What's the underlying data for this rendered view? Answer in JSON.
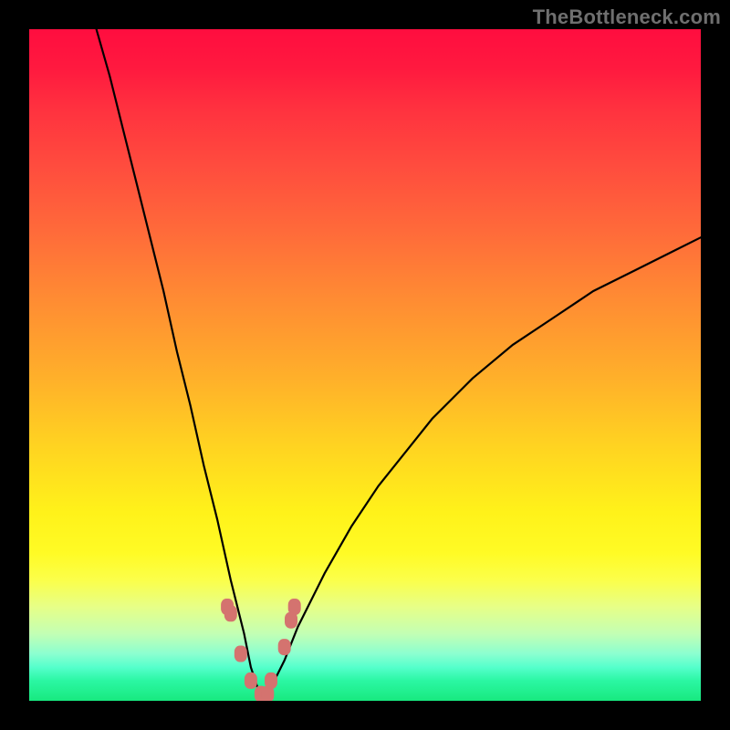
{
  "watermark": "TheBottleneck.com",
  "chart_data": {
    "type": "line",
    "title": "",
    "xlabel": "",
    "ylabel": "",
    "xlim": [
      0,
      100
    ],
    "ylim": [
      0,
      100
    ],
    "background_gradient": {
      "top_color": "#ff0d3f",
      "bottom_color": "#18e97f",
      "meaning": "bottleneck severity (red=high, green=low)"
    },
    "series": [
      {
        "name": "bottleneck-curve",
        "stroke": "#000000",
        "x": [
          10,
          12,
          14,
          16,
          18,
          20,
          22,
          24,
          26,
          28,
          30,
          32,
          33,
          34,
          35,
          36,
          38,
          40,
          44,
          48,
          52,
          56,
          60,
          66,
          72,
          78,
          84,
          90,
          96,
          100
        ],
        "values": [
          100,
          93,
          85,
          77,
          69,
          61,
          52,
          44,
          35,
          27,
          18,
          10,
          5,
          2,
          0,
          2,
          6,
          11,
          19,
          26,
          32,
          37,
          42,
          48,
          53,
          57,
          61,
          64,
          67,
          69
        ]
      },
      {
        "name": "trough-markers",
        "type": "scatter",
        "color": "#d4736f",
        "x": [
          29.5,
          30.0,
          31.5,
          33.0,
          34.5,
          35.5,
          36.0,
          38.0,
          39.0,
          39.5
        ],
        "values": [
          14,
          13,
          7,
          3,
          1,
          1,
          3,
          8,
          12,
          14
        ]
      }
    ]
  }
}
